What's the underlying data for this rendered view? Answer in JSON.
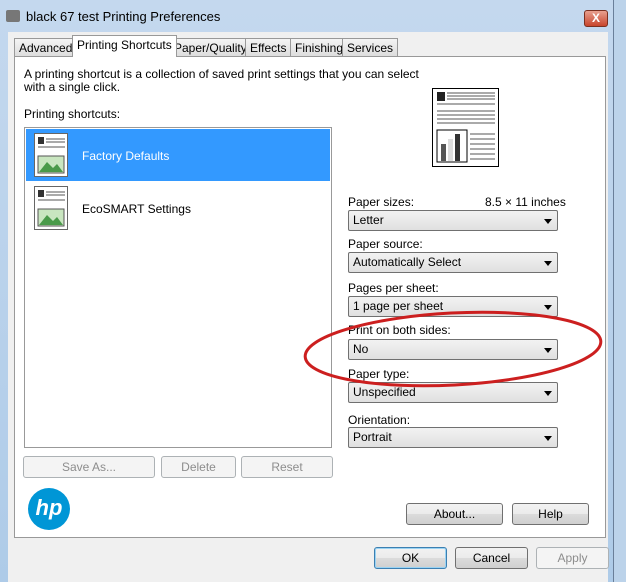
{
  "window": {
    "title": "black 67 test Printing Preferences",
    "close": "X"
  },
  "tabs": [
    "Advanced",
    "Printing Shortcuts",
    "Paper/Quality",
    "Effects",
    "Finishing",
    "Services"
  ],
  "description_line1": "A printing shortcut is a collection of saved print settings that you can select",
  "description_line2": "with a single click.",
  "shortcuts_label": "Printing shortcuts:",
  "shortcuts": [
    {
      "label": "Factory Defaults",
      "selected": true
    },
    {
      "label": "EcoSMART Settings",
      "selected": false
    }
  ],
  "list_buttons": {
    "save_as": "Save As...",
    "delete": "Delete",
    "reset": "Reset"
  },
  "paper_size_note": "8.5 × 11 inches",
  "fields": [
    {
      "label": "Paper sizes:",
      "value": "Letter"
    },
    {
      "label": "Paper source:",
      "value": "Automatically Select"
    },
    {
      "label": "Pages per sheet:",
      "value": "1 page per sheet"
    },
    {
      "label": "Print on both sides:",
      "value": "No"
    },
    {
      "label": "Paper type:",
      "value": "Unspecified"
    },
    {
      "label": "Orientation:",
      "value": "Portrait"
    }
  ],
  "logo": "hp",
  "buttons": {
    "about": "About...",
    "help": "Help",
    "ok": "OK",
    "cancel": "Cancel",
    "apply": "Apply"
  },
  "annotation_color": "#cc1f1f",
  "selection_color": "#3399ff"
}
